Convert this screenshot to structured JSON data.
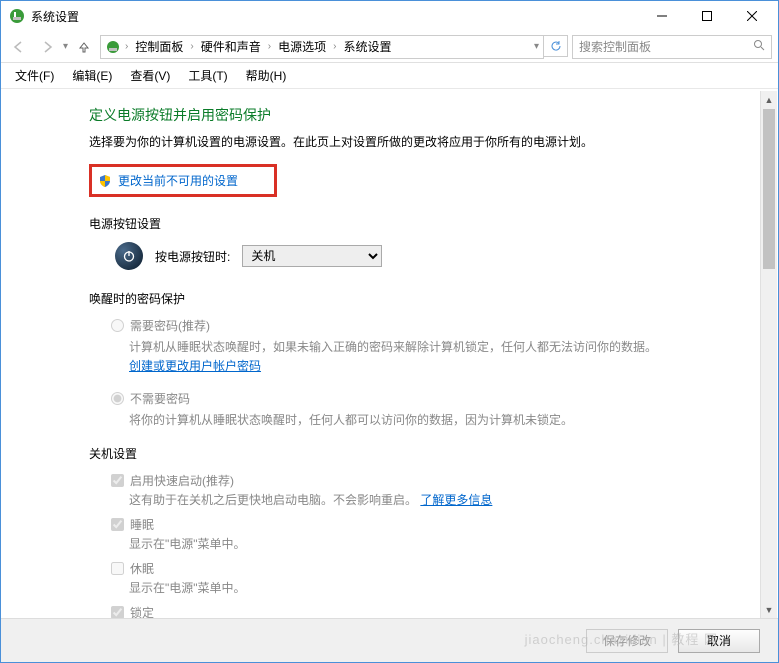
{
  "window": {
    "title": "系统设置"
  },
  "nav": {
    "search_placeholder": "搜索控制面板"
  },
  "breadcrumb": {
    "c1": "控制面板",
    "c2": "硬件和声音",
    "c3": "电源选项",
    "c4": "系统设置"
  },
  "menu": {
    "file": "文件(F)",
    "edit": "编辑(E)",
    "view": "查看(V)",
    "tools": "工具(T)",
    "help": "帮助(H)"
  },
  "main": {
    "heading": "定义电源按钮并启用密码保护",
    "desc": "选择要为你的计算机设置的电源设置。在此页上对设置所做的更改将应用于你所有的电源计划。",
    "change_unavailable": "更改当前不可用的设置",
    "power_button_section": "电源按钮设置",
    "press_power_label": "按电源按钮时:",
    "press_power_value": "关机",
    "wake_section": "唤醒时的密码保护",
    "need_pwd": "需要密码(推荐)",
    "need_pwd_desc": "计算机从睡眠状态唤醒时，如果未输入正确的密码来解除计算机锁定，任何人都无法访问你的数据。",
    "create_pwd_link": "创建或更改用户帐户密码",
    "no_pwd": "不需要密码",
    "no_pwd_desc": "将你的计算机从睡眠状态唤醒时，任何人都可以访问你的数据，因为计算机未锁定。",
    "shutdown_section": "关机设置",
    "fast_startup": "启用快速启动(推荐)",
    "fast_startup_desc_a": "这有助于在关机之后更快地启动电脑。不会影响重启。",
    "learn_more": "了解更多信息",
    "sleep": "睡眠",
    "sleep_desc": "显示在\"电源\"菜单中。",
    "hibernate": "休眠",
    "hibernate_desc": "显示在\"电源\"菜单中。",
    "lock": "锁定"
  },
  "footer": {
    "save": "保存修改",
    "cancel": "取消"
  }
}
